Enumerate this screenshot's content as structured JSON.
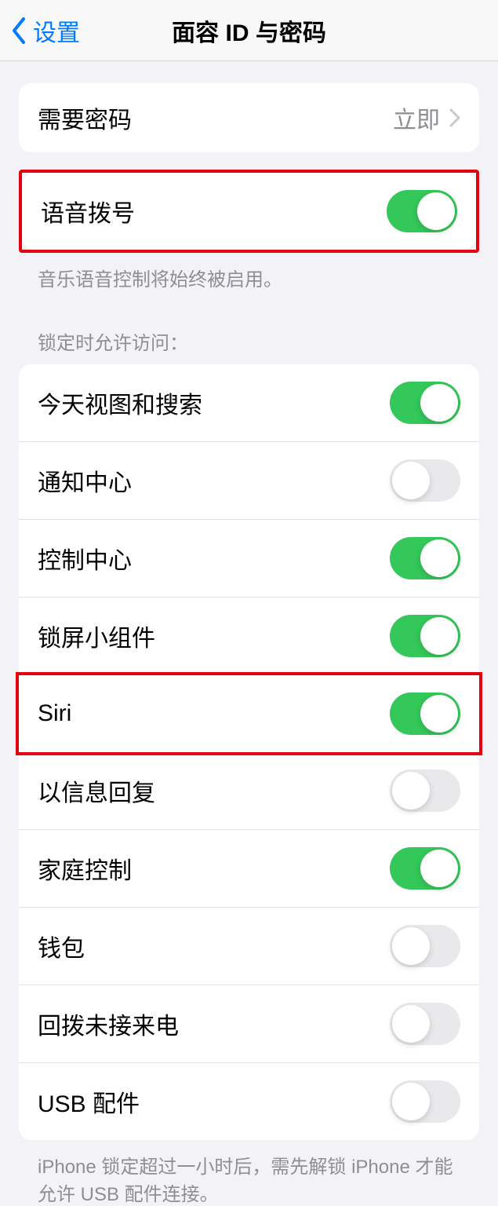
{
  "header": {
    "back_label": "设置",
    "title": "面容 ID 与密码"
  },
  "require_password": {
    "label": "需要密码",
    "value": "立即"
  },
  "voice_dial": {
    "label": "语音拨号",
    "on": true,
    "footer": "音乐语音控制将始终被启用。"
  },
  "locked_access": {
    "header": "锁定时允许访问：",
    "items": [
      {
        "label": "今天视图和搜索",
        "on": true
      },
      {
        "label": "通知中心",
        "on": false
      },
      {
        "label": "控制中心",
        "on": true
      },
      {
        "label": "锁屏小组件",
        "on": true
      },
      {
        "label": "Siri",
        "on": true
      },
      {
        "label": "以信息回复",
        "on": false
      },
      {
        "label": "家庭控制",
        "on": true
      },
      {
        "label": "钱包",
        "on": false
      },
      {
        "label": "回拨未接来电",
        "on": false
      },
      {
        "label": "USB 配件",
        "on": false
      }
    ],
    "footer": "iPhone 锁定超过一小时后，需先解锁 iPhone 才能允许 USB 配件连接。"
  }
}
